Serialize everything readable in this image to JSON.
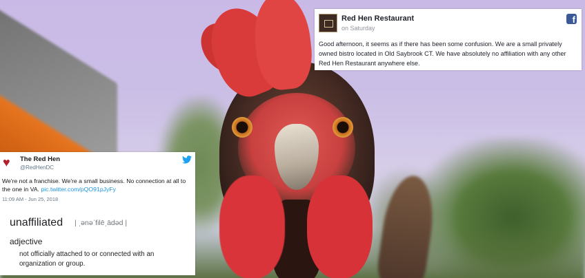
{
  "facebook_post": {
    "author": "Red Hen Restaurant",
    "timestamp": "on Saturday",
    "icon": "facebook-logo-icon",
    "body": "Good afternoon, it seems as if there has been some confusion. We are a small privately owned bistro located in Old Saybrook CT. We have absolutely no affiliation with any other Red Hen Restaurant anywhere else."
  },
  "tweet": {
    "name": "The Red Hen",
    "handle": "@RedHenDC",
    "icon": "twitter-bird-icon",
    "text": "We're not a franchise. We're a small business. No connection at all to the one in VA.",
    "link": "pic.twitter.com/pQO91pJyFy",
    "timestamp": "11:09 AM - Jun 25, 2018"
  },
  "definition": {
    "word": "unaffiliated",
    "pronunciation": "| ˌənəˈfilēˌādəd |",
    "part_of_speech": "adjective",
    "meaning": "not officially attached to or connected with an organization or group."
  },
  "colors": {
    "facebook_blue": "#3b5998",
    "twitter_blue": "#1da1f2",
    "link_blue": "#1b95e0",
    "hen_red": "#d8343a"
  }
}
